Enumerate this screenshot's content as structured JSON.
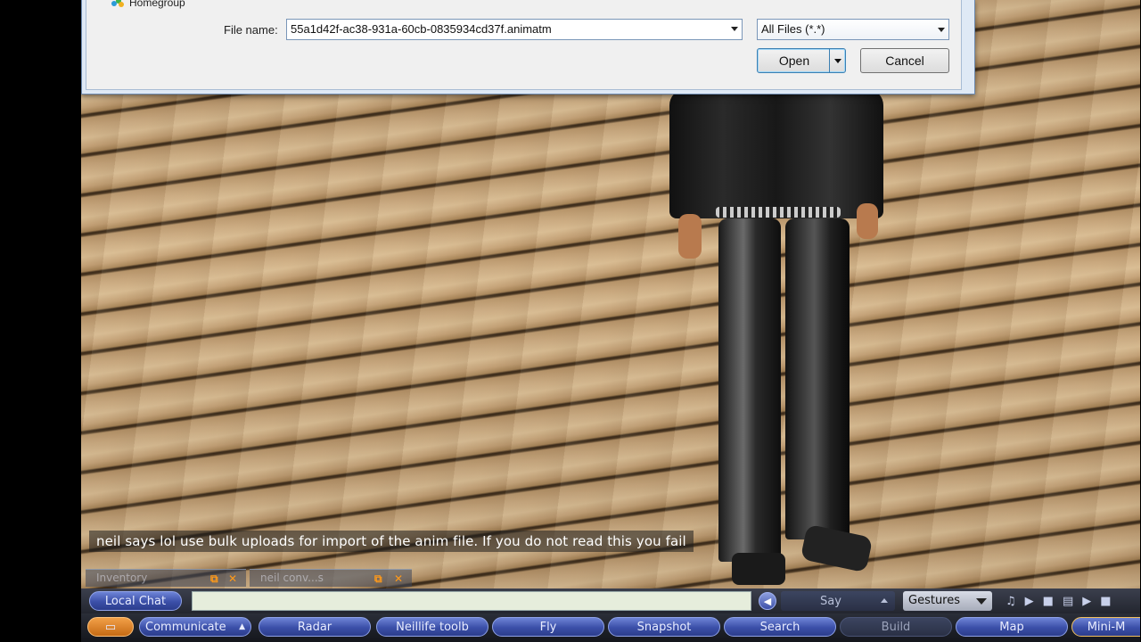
{
  "dialog": {
    "homegroup_label": "Homegroup",
    "file_name_label": "File name:",
    "file_name_value": "55a1d42f-ac38-931a-60cb-0835934cd37f.animatm",
    "file_type_value": "All Files (*.*)",
    "open_label": "Open",
    "cancel_label": "Cancel"
  },
  "chat": {
    "message": "neil says lol use bulk uploads for import of the anim file. If you do not read this you fail"
  },
  "floaters": [
    {
      "label": "Inventory"
    },
    {
      "label": "neil conv...s"
    }
  ],
  "chatbar": {
    "local_chat_label": "Local Chat",
    "say_label": "Say",
    "gestures_label": "Gestures"
  },
  "toolbar": {
    "communicate_label": "Communicate",
    "radar_label": "Radar",
    "neillife_label": "Neillife toolb",
    "fly_label": "Fly",
    "snapshot_label": "Snapshot",
    "search_label": "Search",
    "build_label": "Build",
    "map_label": "Map",
    "minimap_label": "Mini-M"
  },
  "colors": {
    "button_blue": "#3b4fa8",
    "warning_orange": "#ff9a1a"
  }
}
